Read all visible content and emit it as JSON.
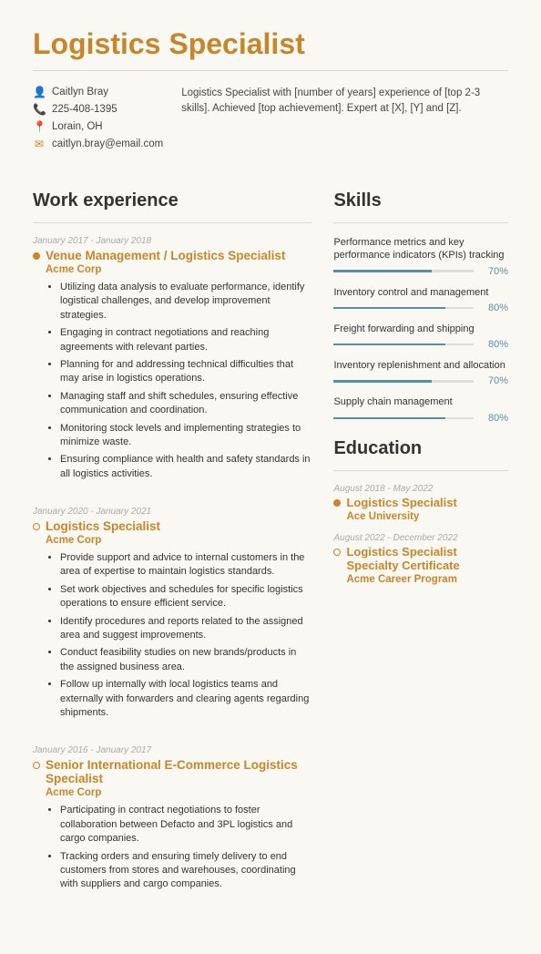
{
  "title": "Logistics Specialist",
  "contact": {
    "name": "Caitlyn Bray",
    "phone": "225-408-1395",
    "location": "Lorain, OH",
    "email": "caitlyn.bray@email.com"
  },
  "summary": "Logistics Specialist with [number of years] experience of [top 2-3 skills]. Achieved [top achievement]. Expert at [X], [Y] and [Z].",
  "sections": {
    "work_experience": "Work experience",
    "skills": "Skills",
    "education": "Education"
  },
  "jobs": [
    {
      "date": "January 2017 - January 2018",
      "title": "Venue Management / Logistics Specialist",
      "company": "Acme Corp",
      "bullets": [
        "Utilizing data analysis to evaluate performance, identify logistical challenges, and develop improvement strategies.",
        "Engaging in contract negotiations and reaching agreements with relevant parties.",
        "Planning for and addressing technical difficulties that may arise in logistics operations.",
        "Managing staff and shift schedules, ensuring effective communication and coordination.",
        "Monitoring stock levels and implementing strategies to minimize waste.",
        "Ensuring compliance with health and safety standards in all logistics activities."
      ],
      "dot": "filled"
    },
    {
      "date": "January 2020 - January 2021",
      "title": "Logistics Specialist",
      "company": "Acme Corp",
      "bullets": [
        "Provide support and advice to internal customers in the area of expertise to maintain logistics standards.",
        "Set work objectives and schedules for specific logistics operations to ensure efficient service.",
        "Identify procedures and reports related to the assigned area and suggest improvements.",
        "Conduct feasibility studies on new brands/products in the assigned business area.",
        "Follow up internally with local logistics teams and externally with forwarders and clearing agents regarding shipments."
      ],
      "dot": "empty"
    },
    {
      "date": "January 2016 - January 2017",
      "title": "Senior International E-Commerce Logistics Specialist",
      "company": "Acme Corp",
      "bullets": [
        "Participating in contract negotiations to foster collaboration between Defacto and 3PL logistics and cargo companies.",
        "Tracking orders and ensuring timely delivery to end customers from stores and warehouses, coordinating with suppliers and cargo companies."
      ],
      "dot": "empty"
    }
  ],
  "skills": [
    {
      "label": "Performance metrics and key performance indicators (KPIs) tracking",
      "pct": 70
    },
    {
      "label": "Inventory control and management",
      "pct": 80
    },
    {
      "label": "Freight forwarding and shipping",
      "pct": 80
    },
    {
      "label": "Inventory replenishment and allocation",
      "pct": 70
    },
    {
      "label": "Supply chain management",
      "pct": 80
    }
  ],
  "education": [
    {
      "date": "August 2018 - May 2022",
      "title": "Logistics Specialist",
      "institution": "Ace University",
      "dot": "filled"
    },
    {
      "date": "August 2022 - December 2022",
      "title": "Logistics Specialist Specialty Certificate",
      "institution": "Acme Career Program",
      "dot": "empty"
    }
  ]
}
